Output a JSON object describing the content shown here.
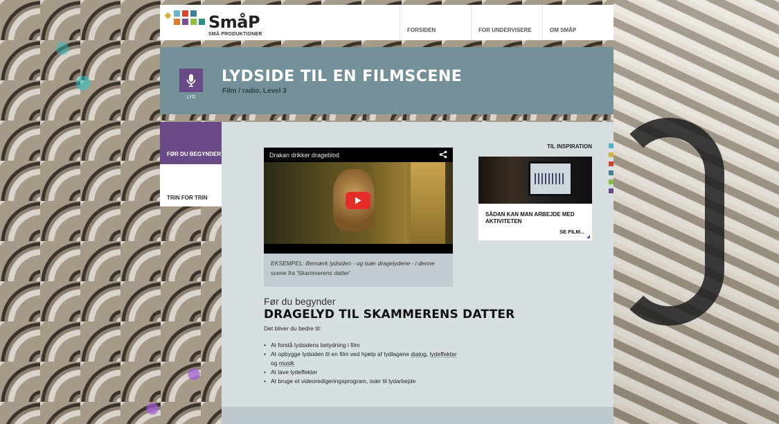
{
  "header": {
    "logo_text": "SmåP",
    "logo_subtitle": "SMÅ PRODUKTIONER",
    "logo_colors": [
      "#d4b23a",
      "#6cb4c9",
      "#d8452f",
      "#3f7e9b",
      "#e07d2b",
      "#7a4f90",
      "#8cbf3f",
      "#2b8f82"
    ],
    "nav": [
      {
        "label": "FORSIDEN"
      },
      {
        "label": "FOR UNDERVISERE"
      },
      {
        "label": "OM SMÅP"
      }
    ]
  },
  "title_band": {
    "category_icon": "microphone-icon",
    "category_label": "LYD",
    "title": "LYDSIDE TIL EN FILMSCENE",
    "subtitle": "Film / radio, Level 3",
    "background": "#74919a",
    "category_color": "#6a4a86"
  },
  "sidebar": {
    "items": [
      {
        "label": "FØR DU BEGYNDER",
        "active": true
      },
      {
        "label": "TRIN FOR TRIN",
        "active": false
      }
    ]
  },
  "video": {
    "title": "Drakan drikker drageblod",
    "share_icon": "share-icon",
    "play_icon": "play-icon",
    "caption": "EKSEMPEL: Bemærk lydsiden - og især dragelydene - i denne scene fra 'Skammerens datter'"
  },
  "content": {
    "pre_heading": "Før du begynder",
    "heading": "DRAGELYD TIL SKAMMERENS DATTER",
    "intro": "Det bliver du bedre til:",
    "goals": [
      {
        "text": "At forstå lydsidens betydning i film"
      },
      {
        "text_before": "At opbygge lydsiden til en film ved hjælp af lydlagene ",
        "link1": "dialog",
        "sep": ", ",
        "link2": "lydeffekter",
        "mid": " og ",
        "link3": "musik"
      },
      {
        "text": "At lave lydeffekter"
      },
      {
        "text": "At bruge et videoredigeringsprogram, især til lydarbejde"
      }
    ]
  },
  "inspiration": {
    "label": "TIL INSPIRATION",
    "card_title": "SÅDAN KAN MAN ARBEJDE MED AKTIVITETEN",
    "card_link": "SE FILM..."
  },
  "color_strip": [
    "#4bb3c4",
    "#d4b23a",
    "#d8452f",
    "#3f7e9b",
    "#8cbf3f",
    "#6a4a86"
  ]
}
